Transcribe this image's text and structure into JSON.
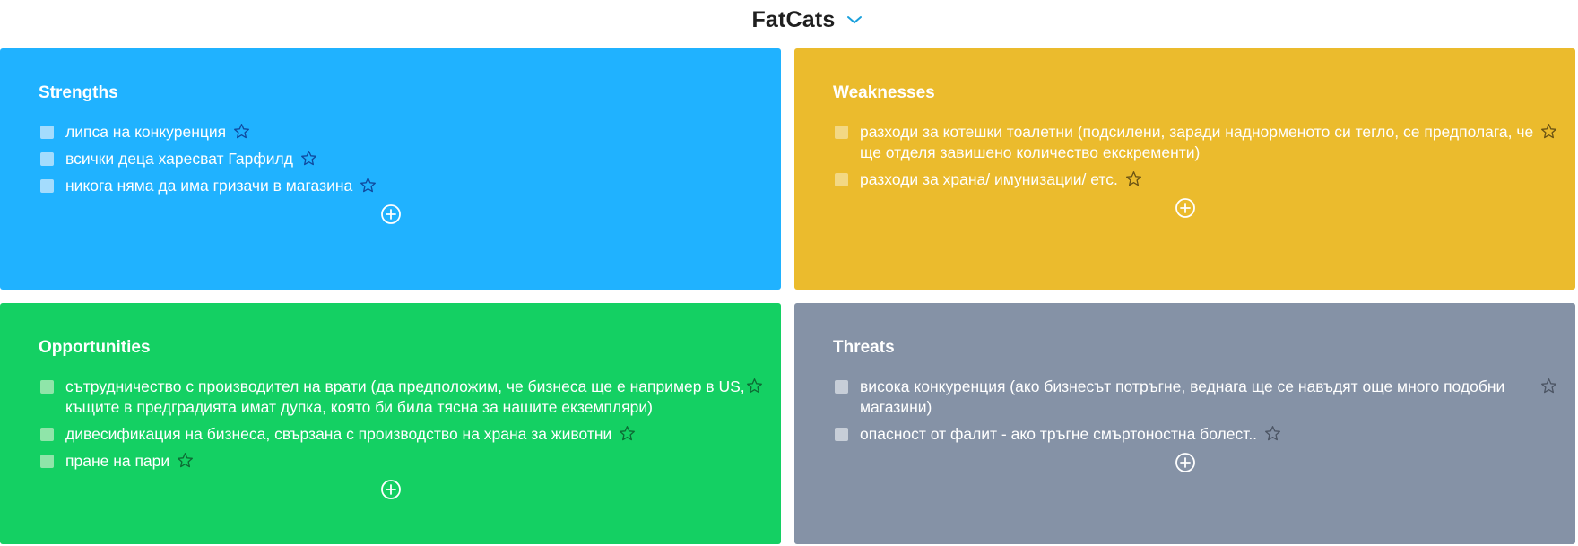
{
  "header": {
    "title": "FatCats",
    "chevron_icon": "chevron-down-icon",
    "chevron_color": "#1aa0dc"
  },
  "quadrants": [
    {
      "key": "strengths",
      "title": "Strengths",
      "color": "#20b2ff",
      "items": [
        "липса на конкуренция",
        "всички деца харесват Гарфилд",
        "никога няма да има гризачи в магазина"
      ]
    },
    {
      "key": "weaknesses",
      "title": "Weaknesses",
      "color": "#ebbb2d",
      "items": [
        "разходи за котешки тоалетни (подсилени, заради наднорменото си тегло, се предполага, че ще отделя завишено количество екскременти)",
        "разходи за храна/ имунизации/ етс."
      ]
    },
    {
      "key": "opportunities",
      "title": "Opportunities",
      "color": "#14d063",
      "items": [
        "сътрудничество с производител на врати (да предположим, че бизнеса ще е например в US, къщите в предградията имат дупка, която би била тясна за нашите екземпляри)",
        "дивесификация на бизнеса, свързана с производство на храна за животни",
        "пране на пари"
      ]
    },
    {
      "key": "threats",
      "title": "Threats",
      "color": "#8592a6",
      "items": [
        "висока конкуренция (ако бизнесът потръгне, веднага ще се навъдят още много подобни магазини)",
        "опасност от фалит - ако тръгне смъртоностна болест.."
      ]
    }
  ],
  "icons": {
    "checkbox": "checkbox-icon",
    "star": "star-icon",
    "add": "add-circle-icon"
  }
}
